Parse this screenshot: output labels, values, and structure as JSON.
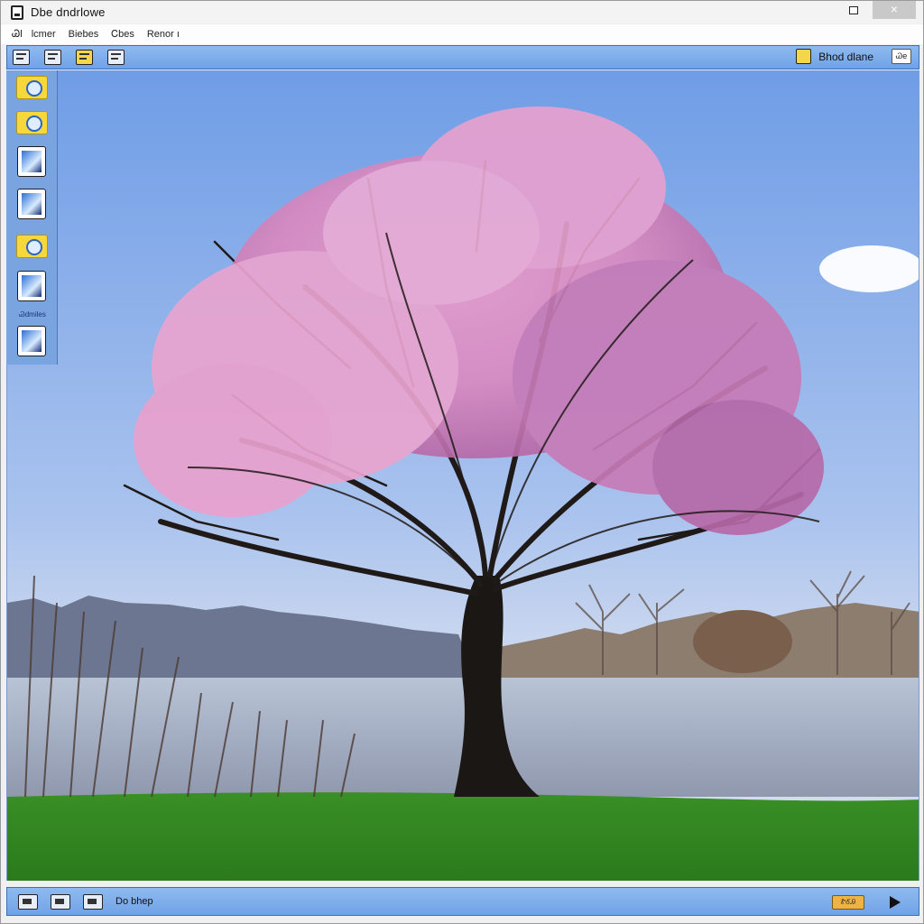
{
  "window": {
    "title": "Dbe dndrlowe",
    "close_glyph": "×"
  },
  "menu": {
    "items": [
      "Ꮚl",
      "lcmer",
      "Biebes",
      "Ꮯbes",
      "Renor  ı"
    ]
  },
  "toolbar": {
    "right_label": "Bhod dlane",
    "mini_label": "Ꮚe"
  },
  "side_panel": {
    "tag": "Ꮚdmiles"
  },
  "status": {
    "text": "Do bhep",
    "badge": "ᏑᎴᎯ"
  },
  "colors": {
    "toolbar": "#7aa9ea",
    "sky_top": "#7fa6e6",
    "grass": "#2f8a22",
    "blossom": "#d77fb8"
  }
}
